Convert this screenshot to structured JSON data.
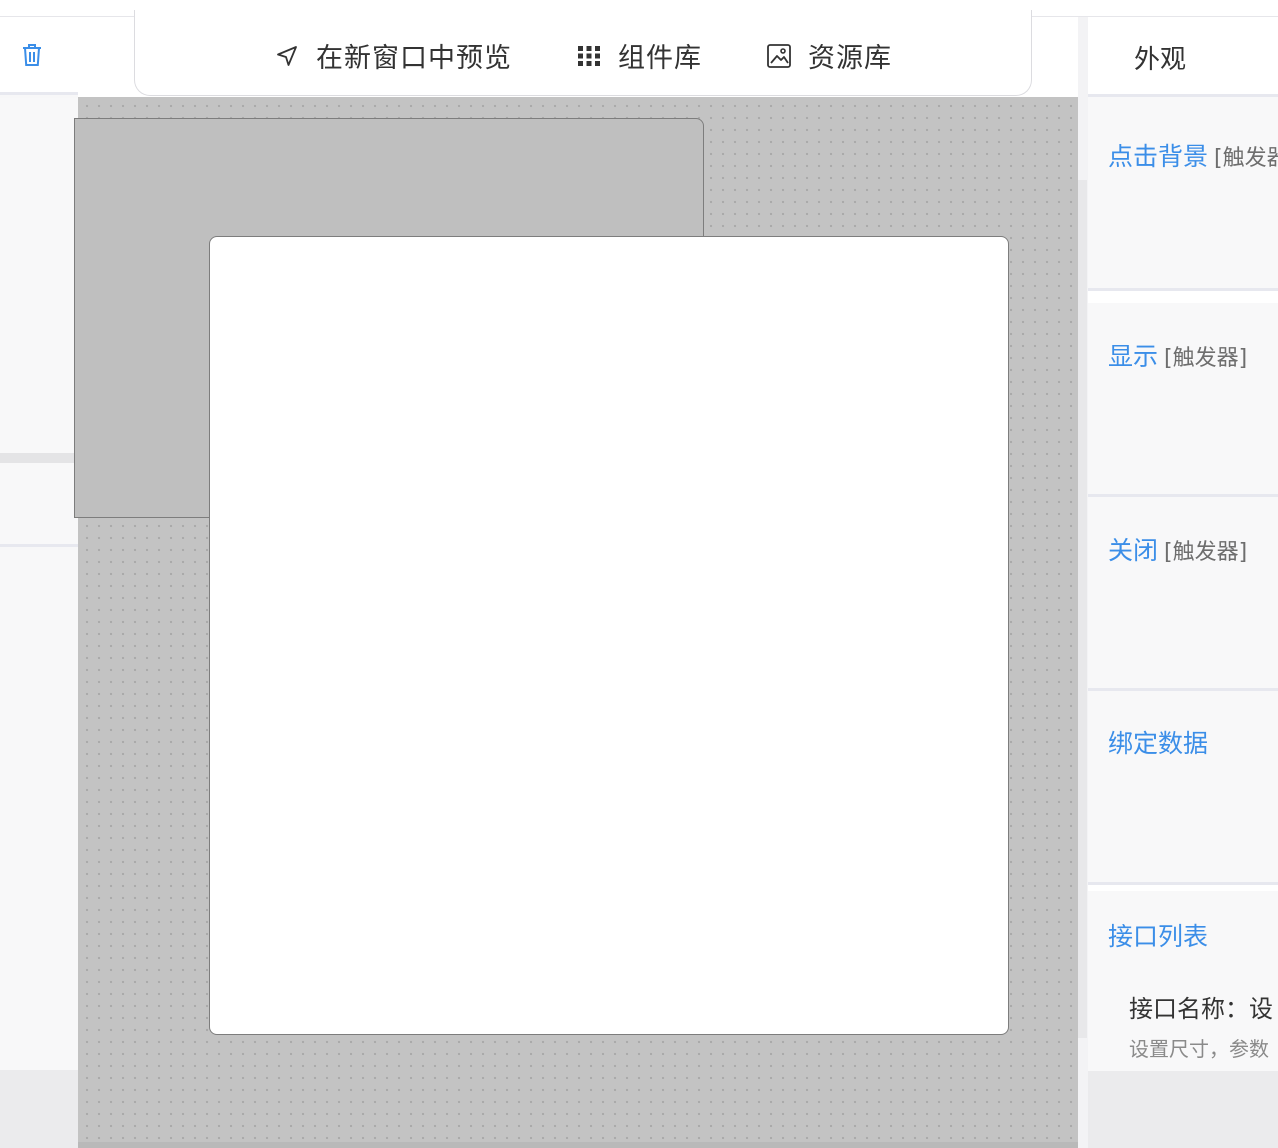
{
  "toolbar": {
    "preview_label": "在新窗口中预览",
    "components_label": "组件库",
    "assets_label": "资源库",
    "preview_icon": "send-arrow-icon",
    "components_icon": "grid-icon",
    "assets_icon": "image-icon"
  },
  "left_panel": {
    "delete_icon": "trash-icon"
  },
  "right_panel": {
    "title": "外观",
    "sections": [
      {
        "name": "点击背景",
        "tag": "[触发器]"
      },
      {
        "name": "显示",
        "tag": "[触发器]"
      },
      {
        "name": "关闭",
        "tag": "[触发器]"
      },
      {
        "name": "绑定数据",
        "tag": ""
      }
    ],
    "api": {
      "title": "接口列表",
      "item_name": "接口名称：设",
      "item_desc": "设置尺寸，参数"
    }
  },
  "colors": {
    "accent": "#3b8ee8",
    "canvas": "#c3c3c3",
    "panel": "#f8f8f9"
  }
}
